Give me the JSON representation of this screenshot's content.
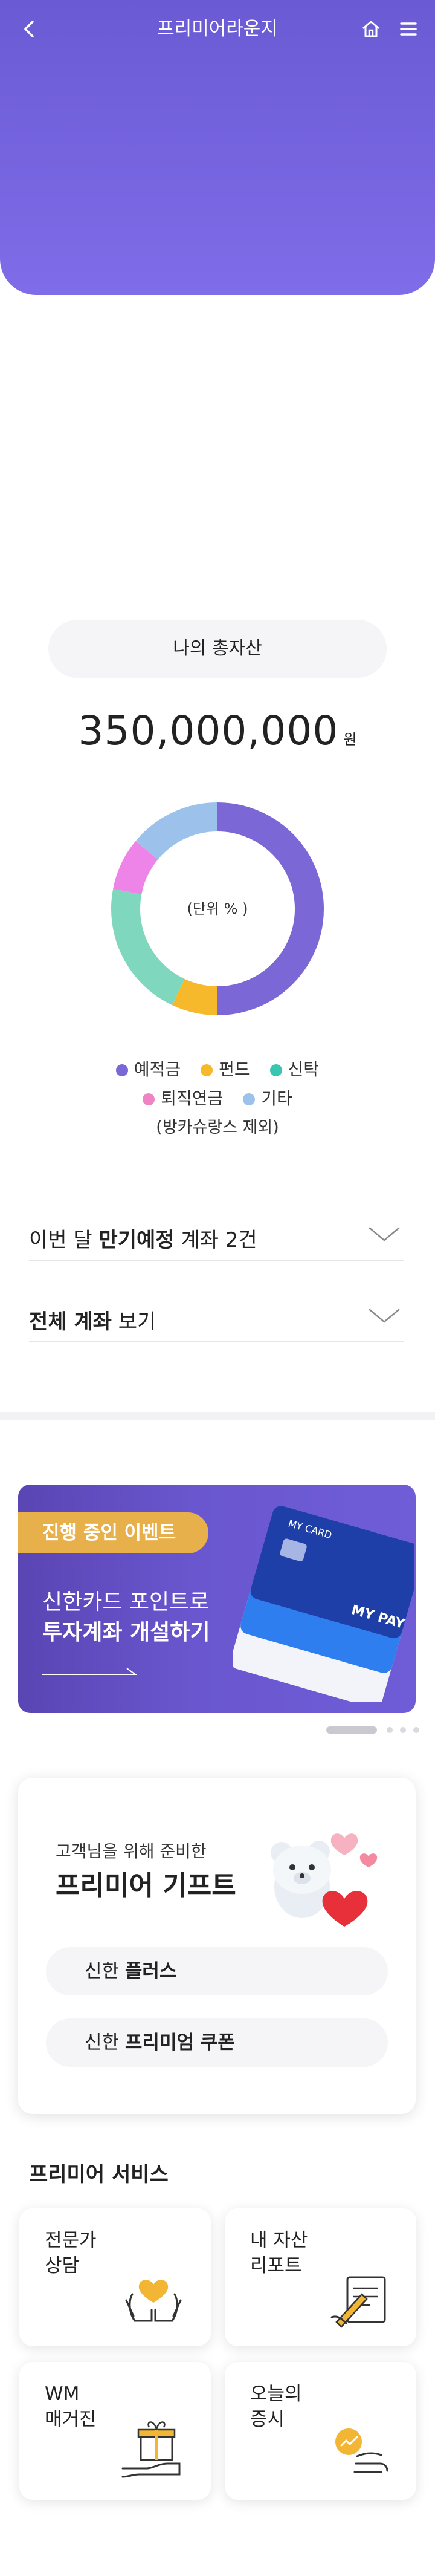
{
  "header": {
    "title": "프리미어라운지",
    "back_icon": "chevron-left-icon",
    "home_icon": "home-icon",
    "menu_icon": "hamburger-menu-icon",
    "colors": {
      "hero_top": "#6a5bd4",
      "hero_bottom": "#7f6ce8"
    }
  },
  "assets": {
    "label": "나의  총자산",
    "total": "350,000,000",
    "unit": "원",
    "chart_center_label": "(단위 % )",
    "legend": [
      {
        "label": "예적금",
        "color": "#7b68d6"
      },
      {
        "label": "펀드",
        "color": "#f6b92b"
      },
      {
        "label": "신탁",
        "color": "#3ac5b0"
      },
      {
        "label": "퇴직연금",
        "color": "#ef84c4"
      },
      {
        "label": "기타",
        "color": "#9cc2ec"
      }
    ],
    "note": "(방카슈랑스 제외)"
  },
  "chart_data": {
    "type": "pie",
    "categories": [
      "예적금",
      "펀드",
      "신탁",
      "퇴직연금",
      "기타"
    ],
    "values": [
      50,
      7,
      21,
      8,
      14
    ],
    "colors": [
      "#7b68d6",
      "#f6b92b",
      "#7fd8bd",
      "#ef84e8",
      "#9cc2ec"
    ],
    "legend": "bottom"
  },
  "rows": {
    "maturity": {
      "prefix": "이번 달 ",
      "bold": "만기예정",
      "suffix": " 계좌 2건"
    },
    "all_accounts": {
      "bold": "전체 계좌",
      "suffix": " 보기"
    }
  },
  "banner": {
    "tag": "진행 중인 이벤트",
    "line1": "신한카드 포인트로",
    "line2": "투자계좌 개설하기",
    "card_text": "MY CARD",
    "card_text2": "MY PAY"
  },
  "gift": {
    "subtitle": "고객님을 위해 준비한",
    "title": "프리미어 기프트",
    "buttons": [
      {
        "prefix": "신한 ",
        "bold": "플러스"
      },
      {
        "prefix": "신한 ",
        "bold": "프리미엄 쿠폰"
      }
    ]
  },
  "services": {
    "title": "프리미어 서비스",
    "tiles": [
      {
        "label": "전문가\n상담",
        "icon": "heart-hands-icon"
      },
      {
        "label": "내 자산\n리포트",
        "icon": "report-pen-icon"
      },
      {
        "label": "WM\n매거진",
        "icon": "gift-box-hand-icon"
      },
      {
        "label": "오늘의\n증시",
        "icon": "chart-coin-hand-icon"
      }
    ]
  }
}
